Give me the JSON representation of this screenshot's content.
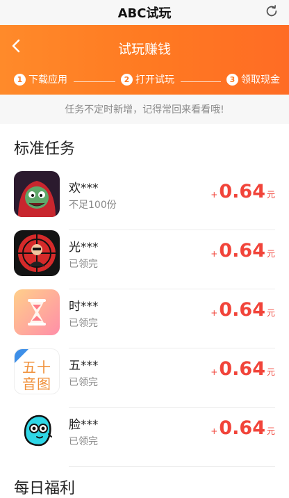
{
  "app": {
    "title": "ABC试玩"
  },
  "header": {
    "title": "试玩赚钱"
  },
  "steps": [
    {
      "num": "1",
      "label": "下载应用"
    },
    {
      "num": "2",
      "label": "打开试玩"
    },
    {
      "num": "3",
      "label": "领取现金"
    }
  ],
  "notice": "任务不定时新增，记得常回来看看哦!",
  "sections": {
    "standard": "标准任务",
    "daily": "每日福利"
  },
  "tasks": [
    {
      "name": "欢***",
      "status": "不足100份",
      "plus": "+",
      "amount": "0.64",
      "unit": "元",
      "icon": "zombie-game-icon"
    },
    {
      "name": "光***",
      "status": "已领完",
      "plus": "+",
      "amount": "0.64",
      "unit": "元",
      "icon": "sniper-scope-icon"
    },
    {
      "name": "时***",
      "status": "已领完",
      "plus": "+",
      "amount": "0.64",
      "unit": "元",
      "icon": "hourglass-icon"
    },
    {
      "name": "五***",
      "status": "已领完",
      "plus": "+",
      "amount": "0.64",
      "unit": "元",
      "icon": "wushi-yintu-icon",
      "icon_text": [
        "五十",
        "音图"
      ]
    },
    {
      "name": "脸***",
      "status": "已领完",
      "plus": "+",
      "amount": "0.64",
      "unit": "元",
      "icon": "cyan-face-icon"
    }
  ],
  "colors": {
    "accent": "#ff7a22",
    "reward": "#f1443a"
  }
}
